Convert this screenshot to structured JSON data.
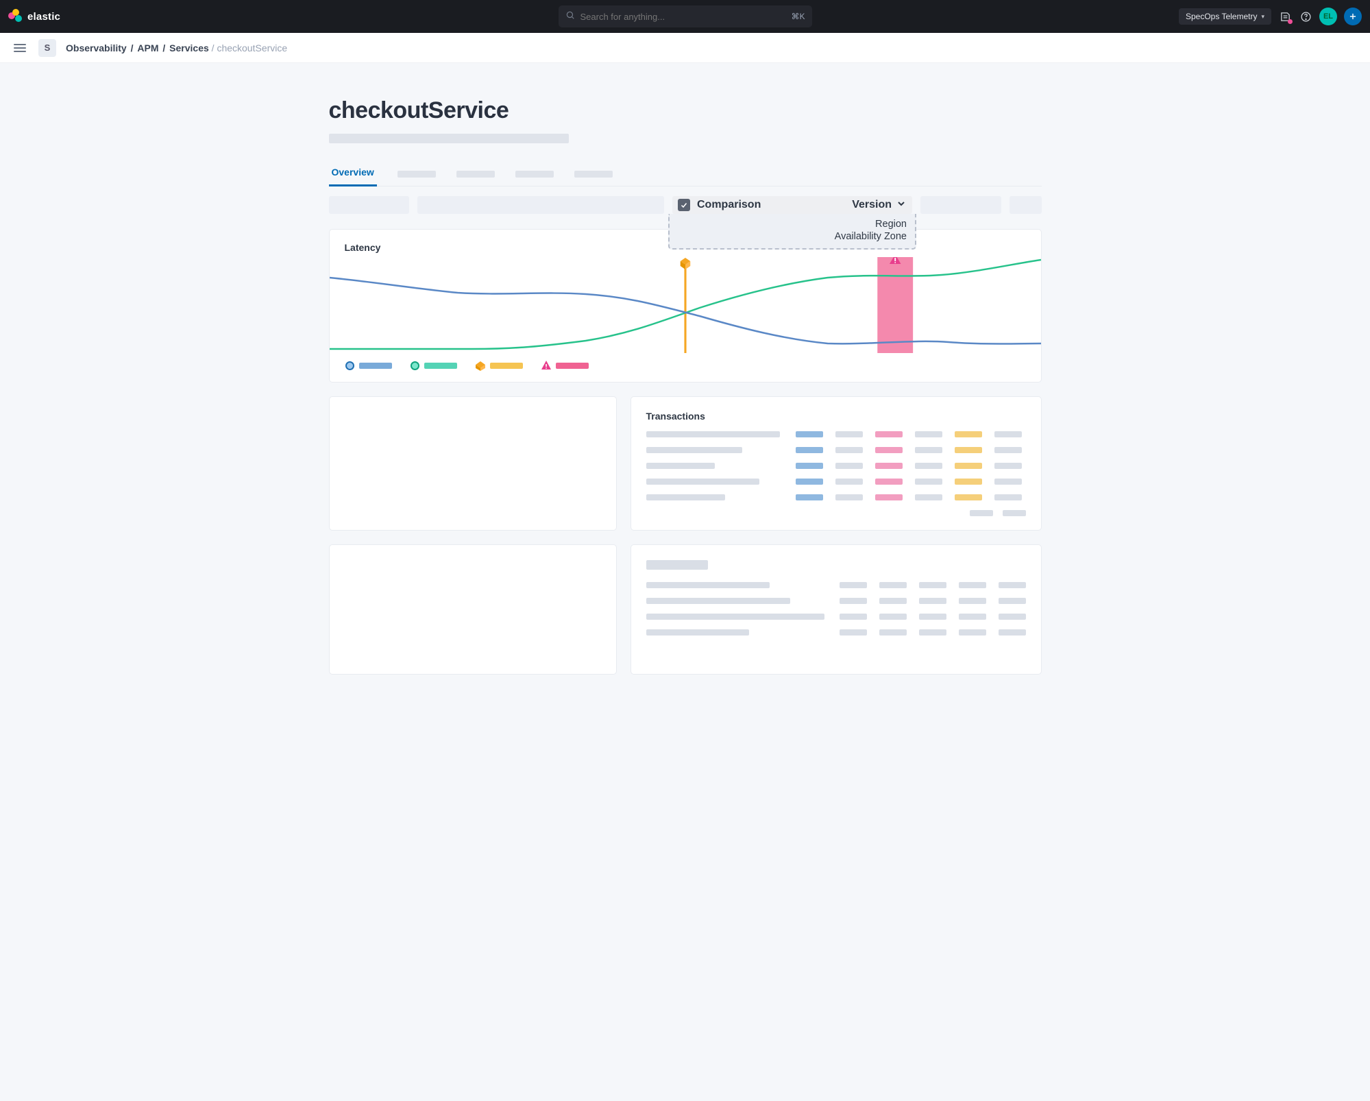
{
  "brand": {
    "name": "elastic"
  },
  "search": {
    "placeholder": "Search for anything...",
    "shortcut": "⌘K"
  },
  "topbar": {
    "deployment_label": "SpecOps Telemetry",
    "avatar_initials": "EL"
  },
  "breadcrumb": {
    "space_initial": "S",
    "segments": [
      "Observability",
      "APM",
      "Services"
    ],
    "current": "checkoutService"
  },
  "page": {
    "title": "checkoutService"
  },
  "tabs": {
    "active": "Overview"
  },
  "comparison": {
    "checkbox_checked": true,
    "label": "Comparison",
    "selected": "Version",
    "options": [
      "Region",
      "Availability Zone"
    ]
  },
  "latency": {
    "title": "Latency",
    "legend": [
      {
        "kind": "circle",
        "color": "#3f8ecf",
        "bar": "#79aad9"
      },
      {
        "kind": "circle",
        "color": "#1fc9a4",
        "bar": "#54d3b5"
      },
      {
        "kind": "cube",
        "color": "#f5a623",
        "bar": "#f5c452"
      },
      {
        "kind": "alert",
        "color": "#e83e8c",
        "bar": "#f06292"
      }
    ]
  },
  "chart_data": {
    "type": "line",
    "xlabel": "",
    "ylabel": "",
    "ylim": [
      0,
      100
    ],
    "x": [
      0,
      10,
      20,
      30,
      40,
      50,
      60,
      70,
      80,
      90,
      100
    ],
    "series": [
      {
        "name": "blue",
        "color": "#5a88c6",
        "values": [
          72,
          66,
          60,
          58,
          62,
          56,
          44,
          26,
          14,
          16,
          14
        ]
      },
      {
        "name": "green",
        "color": "#27c28b",
        "values": [
          4,
          4,
          4,
          4,
          6,
          20,
          40,
          58,
          70,
          64,
          82
        ]
      }
    ],
    "markers": [
      {
        "kind": "deployment",
        "x": 50,
        "color": "#f5a623"
      },
      {
        "kind": "alert-band",
        "x0": 77,
        "x1": 82,
        "color": "#f06292"
      }
    ]
  },
  "transactions": {
    "title": "Transactions"
  }
}
